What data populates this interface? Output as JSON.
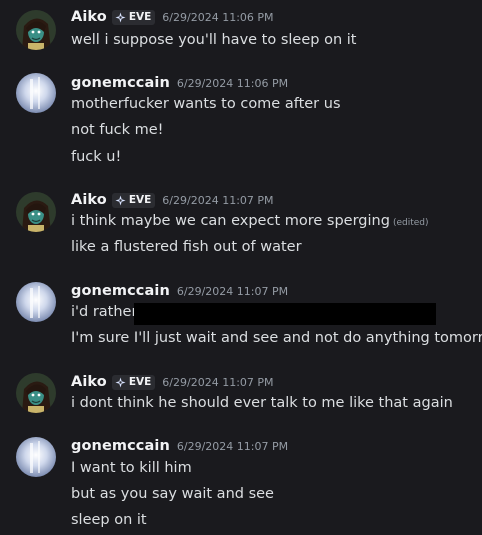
{
  "colors": {
    "background": "#1a1a1e",
    "username": "#f2f3f5",
    "message_text": "#dbdee1",
    "timestamp": "#949ba4",
    "tag_background": "#2b2c31",
    "redaction": "#000000"
  },
  "messages": [
    {
      "author": "Aiko",
      "tag": "EVE",
      "tag_icon": "sparkle-diamond-icon",
      "avatar": "aiko-avatar",
      "timestamp": "6/29/2024 11:06 PM",
      "lines": [
        {
          "text": "well i suppose you'll have to sleep on it"
        }
      ]
    },
    {
      "author": "gonemccain",
      "avatar": "gonemccain-avatar",
      "timestamp": "6/29/2024 11:06 PM",
      "lines": [
        {
          "text": "motherfucker wants to come after us"
        },
        {
          "text": "not fuck me!"
        },
        {
          "text": "fuck u!"
        }
      ]
    },
    {
      "author": "Aiko",
      "tag": "EVE",
      "tag_icon": "sparkle-diamond-icon",
      "avatar": "aiko-avatar",
      "timestamp": "6/29/2024 11:07 PM",
      "lines": [
        {
          "text": "i think maybe we can expect more sperging",
          "edited": "(edited)"
        },
        {
          "text": "like a flustered fish out of water"
        }
      ]
    },
    {
      "author": "gonemccain",
      "avatar": "gonemccain-avatar",
      "timestamp": "6/29/2024 11:07 PM",
      "lines": [
        {
          "text": "i'd rather",
          "redacted": true
        },
        {
          "text": "I'm sure I'll just wait and see and not do anything tomorrow"
        }
      ]
    },
    {
      "author": "Aiko",
      "tag": "EVE",
      "tag_icon": "sparkle-diamond-icon",
      "avatar": "aiko-avatar",
      "timestamp": "6/29/2024 11:07 PM",
      "lines": [
        {
          "text": "i dont think he should ever talk to me like that again"
        }
      ]
    },
    {
      "author": "gonemccain",
      "avatar": "gonemccain-avatar",
      "timestamp": "6/29/2024 11:07 PM",
      "lines": [
        {
          "text": "I want to kill him"
        },
        {
          "text": "but as you say wait and see"
        },
        {
          "text": "sleep on it"
        }
      ]
    }
  ]
}
